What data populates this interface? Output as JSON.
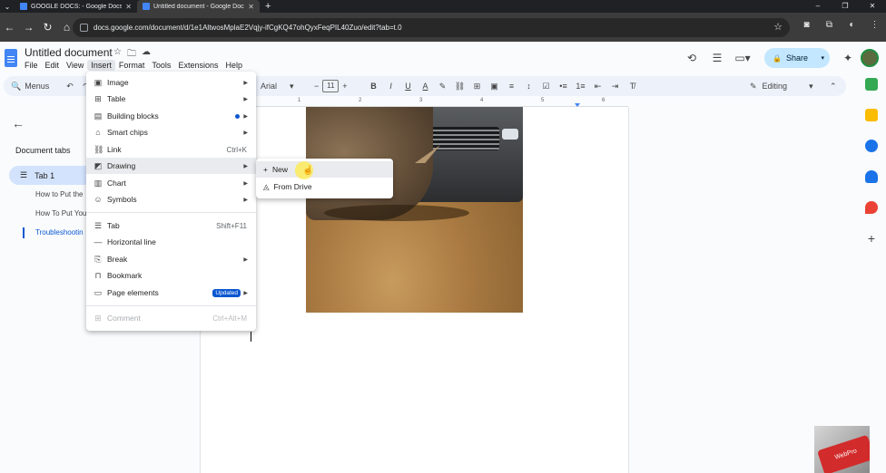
{
  "browser": {
    "tabs": [
      {
        "title": "GOOGLE DOCS: - Google Docs"
      },
      {
        "title": "Untitled document - Google Docs"
      }
    ],
    "url": "docs.google.com/document/d/1e1AltwosMplaE2Vqjy-ifCgKQ47ohQyxFeqPIL40Zuo/edit?tab=t.0"
  },
  "doc": {
    "title": "Untitled document",
    "menus": [
      "File",
      "Edit",
      "View",
      "Insert",
      "Format",
      "Tools",
      "Extensions",
      "Help"
    ],
    "share_label": "Share"
  },
  "toolbar": {
    "menus_label": "Menus",
    "font": "Arial",
    "size": "11",
    "mode": "Editing"
  },
  "sidebar": {
    "header": "Document tabs",
    "tab1": "Tab 1",
    "subs": [
      "How to Put the",
      "How To Put You",
      "Troubleshootin"
    ]
  },
  "ruler": {
    "ticks": [
      "1",
      "2",
      "3",
      "4",
      "5",
      "6"
    ]
  },
  "insert_menu": {
    "items": [
      {
        "label": "Image",
        "shortcut": ""
      },
      {
        "label": "Table",
        "shortcut": ""
      },
      {
        "label": "Building blocks",
        "shortcut": ""
      },
      {
        "label": "Smart chips",
        "shortcut": ""
      },
      {
        "label": "Link",
        "shortcut": "Ctrl+K"
      },
      {
        "label": "Drawing",
        "shortcut": ""
      },
      {
        "label": "Chart",
        "shortcut": ""
      },
      {
        "label": "Symbols",
        "shortcut": ""
      },
      {
        "label": "Tab",
        "shortcut": "Shift+F11"
      },
      {
        "label": "Horizontal line",
        "shortcut": ""
      },
      {
        "label": "Break",
        "shortcut": ""
      },
      {
        "label": "Bookmark",
        "shortcut": ""
      },
      {
        "label": "Page elements",
        "shortcut": ""
      },
      {
        "label": "Comment",
        "shortcut": "Ctrl+Alt+M"
      }
    ],
    "updated_badge": "Updated"
  },
  "drawing_submenu": {
    "items": [
      {
        "label": "New"
      },
      {
        "label": "From Drive"
      }
    ]
  },
  "webcam_label": "WebPro",
  "colors": {
    "accent": "#0b57d0",
    "share_bg": "#c2e7ff",
    "toolbar_bg": "#edf2fa"
  }
}
